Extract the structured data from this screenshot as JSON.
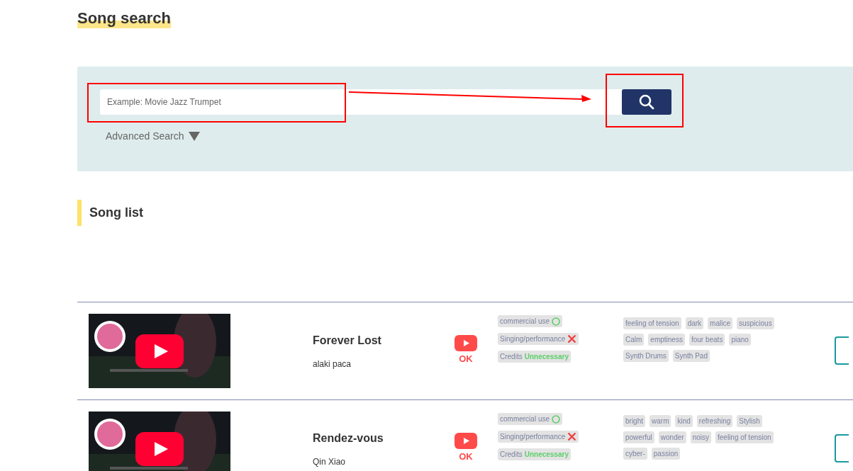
{
  "page_title": "Song search",
  "search": {
    "placeholder": "Example: Movie Jazz Trumpet",
    "advanced_label": "Advanced Search",
    "advanced_expanded": false
  },
  "section_title": "Song list",
  "songs": [
    {
      "title": "Forever Lost",
      "artist": "alaki paca",
      "youtube_status": "OK",
      "rights": [
        {
          "kind": "allowed",
          "label": "commercial use"
        },
        {
          "kind": "denied",
          "label": "Singing/performance"
        },
        {
          "kind": "value",
          "label": "Credits",
          "value": "Unnecessary"
        }
      ],
      "tags": [
        "feeling of tension",
        "dark",
        "malice",
        "suspicious",
        "Calm",
        "emptiness",
        "four beats",
        "piano",
        "Synth Drums",
        "Synth Pad"
      ]
    },
    {
      "title": "Rendez-vous",
      "artist": "Qin Xiao",
      "youtube_status": "OK",
      "rights": [
        {
          "kind": "allowed",
          "label": "commercial use"
        },
        {
          "kind": "denied",
          "label": "Singing/performance"
        },
        {
          "kind": "value",
          "label": "Credits",
          "value": "Unnecessary"
        }
      ],
      "tags": [
        "bright",
        "warm",
        "kind",
        "refreshing",
        "Stylish",
        "powerful",
        "wonder",
        "noisy",
        "feeling of tension",
        "cyber-",
        "passion"
      ]
    }
  ]
}
